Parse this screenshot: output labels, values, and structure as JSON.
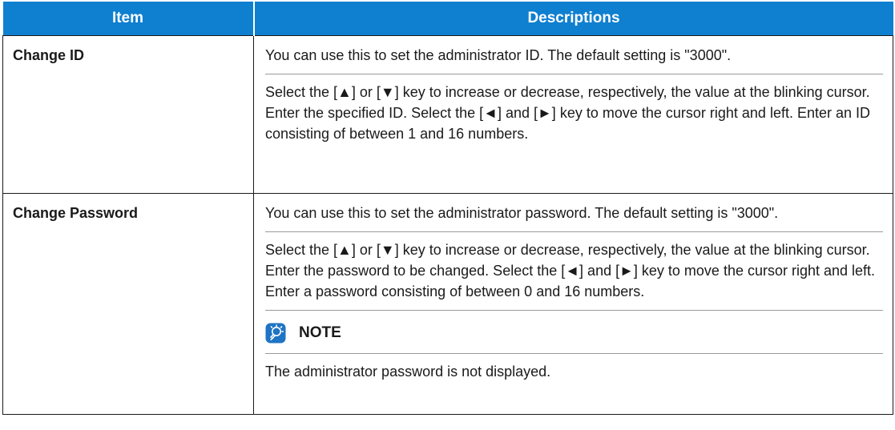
{
  "table": {
    "headers": {
      "item": "Item",
      "descriptions": "Descriptions"
    },
    "rows": [
      {
        "item": "Change ID",
        "desc_p1": "You can use this to set the administrator ID. The default setting is \"3000\".",
        "desc_p2": "Select the [▲] or [▼] key to increase or decrease, respectively, the value at the blinking cursor. Enter the specified ID. Select the [◄] and [►] key to move the cursor right and left. Enter an ID consisting of between 1 and 16 numbers."
      },
      {
        "item": "Change Password",
        "desc_p1": "You can use this to set the administrator password. The default setting is \"3000\".",
        "desc_p2": "Select the [▲] or [▼] key to increase or decrease, respectively, the value at the blinking cursor. Enter the password to be changed. Select the [◄] and [►] key to move the cursor right and left. Enter a password consisting of between 0 and 16 numbers.",
        "note_label": "NOTE",
        "note_text": "The administrator password is not displayed."
      }
    ]
  },
  "colors": {
    "header_bg": "#0f7fd0",
    "header_text": "#ffffff",
    "note_icon": "#1f74c4"
  },
  "icons": {
    "note": "lightbulb-note-icon"
  }
}
